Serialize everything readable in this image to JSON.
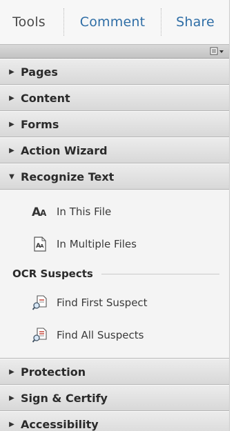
{
  "tabs": {
    "tools": "Tools",
    "comment": "Comment",
    "share": "Share"
  },
  "sections": {
    "pages": "Pages",
    "content": "Content",
    "forms": "Forms",
    "action_wizard": "Action Wizard",
    "recognize_text": "Recognize Text",
    "protection": "Protection",
    "sign_certify": "Sign & Certify",
    "accessibility": "Accessibility"
  },
  "recognize_text": {
    "in_this_file": "In This File",
    "in_multiple_files": "In Multiple Files",
    "ocr_group": "OCR Suspects",
    "find_first": "Find First Suspect",
    "find_all": "Find All Suspects"
  },
  "colors": {
    "tab_link": "#2f6ea6",
    "header_bg": "#dcdcdc",
    "panel_bg": "#f4f4f4"
  },
  "icons": {
    "options": "panel-options-icon",
    "in_this_file": "text-aa-icon",
    "in_multiple_files": "document-aa-icon",
    "find_first": "find-suspect-icon",
    "find_all": "find-all-suspects-icon"
  }
}
